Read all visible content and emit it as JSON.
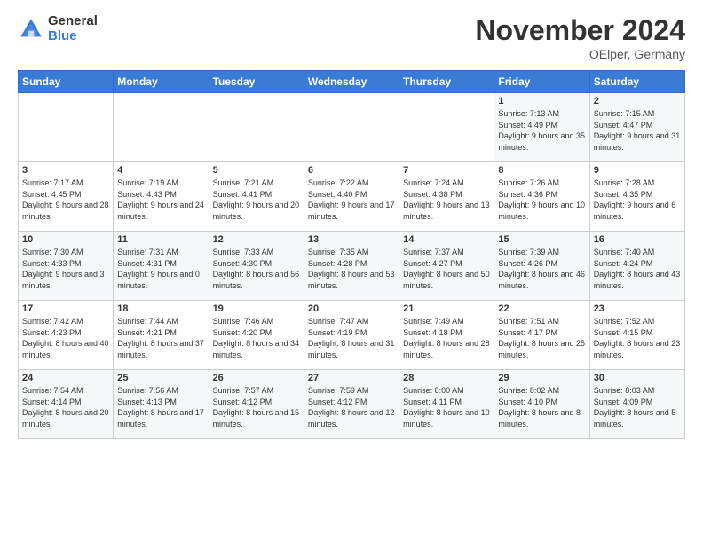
{
  "logo": {
    "general": "General",
    "blue": "Blue"
  },
  "header": {
    "month": "November 2024",
    "location": "OElper, Germany"
  },
  "days_of_week": [
    "Sunday",
    "Monday",
    "Tuesday",
    "Wednesday",
    "Thursday",
    "Friday",
    "Saturday"
  ],
  "weeks": [
    [
      {
        "day": "",
        "info": ""
      },
      {
        "day": "",
        "info": ""
      },
      {
        "day": "",
        "info": ""
      },
      {
        "day": "",
        "info": ""
      },
      {
        "day": "",
        "info": ""
      },
      {
        "day": "1",
        "info": "Sunrise: 7:13 AM\nSunset: 4:49 PM\nDaylight: 9 hours and 35 minutes."
      },
      {
        "day": "2",
        "info": "Sunrise: 7:15 AM\nSunset: 4:47 PM\nDaylight: 9 hours and 31 minutes."
      }
    ],
    [
      {
        "day": "3",
        "info": "Sunrise: 7:17 AM\nSunset: 4:45 PM\nDaylight: 9 hours and 28 minutes."
      },
      {
        "day": "4",
        "info": "Sunrise: 7:19 AM\nSunset: 4:43 PM\nDaylight: 9 hours and 24 minutes."
      },
      {
        "day": "5",
        "info": "Sunrise: 7:21 AM\nSunset: 4:41 PM\nDaylight: 9 hours and 20 minutes."
      },
      {
        "day": "6",
        "info": "Sunrise: 7:22 AM\nSunset: 4:40 PM\nDaylight: 9 hours and 17 minutes."
      },
      {
        "day": "7",
        "info": "Sunrise: 7:24 AM\nSunset: 4:38 PM\nDaylight: 9 hours and 13 minutes."
      },
      {
        "day": "8",
        "info": "Sunrise: 7:26 AM\nSunset: 4:36 PM\nDaylight: 9 hours and 10 minutes."
      },
      {
        "day": "9",
        "info": "Sunrise: 7:28 AM\nSunset: 4:35 PM\nDaylight: 9 hours and 6 minutes."
      }
    ],
    [
      {
        "day": "10",
        "info": "Sunrise: 7:30 AM\nSunset: 4:33 PM\nDaylight: 9 hours and 3 minutes."
      },
      {
        "day": "11",
        "info": "Sunrise: 7:31 AM\nSunset: 4:31 PM\nDaylight: 9 hours and 0 minutes."
      },
      {
        "day": "12",
        "info": "Sunrise: 7:33 AM\nSunset: 4:30 PM\nDaylight: 8 hours and 56 minutes."
      },
      {
        "day": "13",
        "info": "Sunrise: 7:35 AM\nSunset: 4:28 PM\nDaylight: 8 hours and 53 minutes."
      },
      {
        "day": "14",
        "info": "Sunrise: 7:37 AM\nSunset: 4:27 PM\nDaylight: 8 hours and 50 minutes."
      },
      {
        "day": "15",
        "info": "Sunrise: 7:39 AM\nSunset: 4:26 PM\nDaylight: 8 hours and 46 minutes."
      },
      {
        "day": "16",
        "info": "Sunrise: 7:40 AM\nSunset: 4:24 PM\nDaylight: 8 hours and 43 minutes."
      }
    ],
    [
      {
        "day": "17",
        "info": "Sunrise: 7:42 AM\nSunset: 4:23 PM\nDaylight: 8 hours and 40 minutes."
      },
      {
        "day": "18",
        "info": "Sunrise: 7:44 AM\nSunset: 4:21 PM\nDaylight: 8 hours and 37 minutes."
      },
      {
        "day": "19",
        "info": "Sunrise: 7:46 AM\nSunset: 4:20 PM\nDaylight: 8 hours and 34 minutes."
      },
      {
        "day": "20",
        "info": "Sunrise: 7:47 AM\nSunset: 4:19 PM\nDaylight: 8 hours and 31 minutes."
      },
      {
        "day": "21",
        "info": "Sunrise: 7:49 AM\nSunset: 4:18 PM\nDaylight: 8 hours and 28 minutes."
      },
      {
        "day": "22",
        "info": "Sunrise: 7:51 AM\nSunset: 4:17 PM\nDaylight: 8 hours and 25 minutes."
      },
      {
        "day": "23",
        "info": "Sunrise: 7:52 AM\nSunset: 4:15 PM\nDaylight: 8 hours and 23 minutes."
      }
    ],
    [
      {
        "day": "24",
        "info": "Sunrise: 7:54 AM\nSunset: 4:14 PM\nDaylight: 8 hours and 20 minutes."
      },
      {
        "day": "25",
        "info": "Sunrise: 7:56 AM\nSunset: 4:13 PM\nDaylight: 8 hours and 17 minutes."
      },
      {
        "day": "26",
        "info": "Sunrise: 7:57 AM\nSunset: 4:12 PM\nDaylight: 8 hours and 15 minutes."
      },
      {
        "day": "27",
        "info": "Sunrise: 7:59 AM\nSunset: 4:12 PM\nDaylight: 8 hours and 12 minutes."
      },
      {
        "day": "28",
        "info": "Sunrise: 8:00 AM\nSunset: 4:11 PM\nDaylight: 8 hours and 10 minutes."
      },
      {
        "day": "29",
        "info": "Sunrise: 8:02 AM\nSunset: 4:10 PM\nDaylight: 8 hours and 8 minutes."
      },
      {
        "day": "30",
        "info": "Sunrise: 8:03 AM\nSunset: 4:09 PM\nDaylight: 8 hours and 5 minutes."
      }
    ]
  ]
}
